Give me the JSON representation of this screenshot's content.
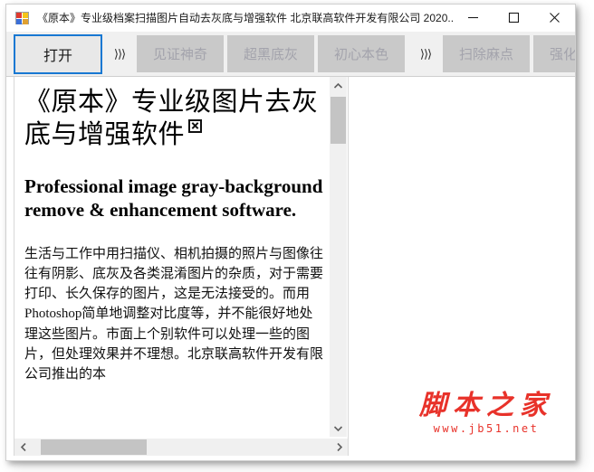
{
  "window": {
    "title": "《原本》专业级档案扫描图片自动去灰底与增强软件 北京联高软件开发有限公司 2020...",
    "icon": "app-grid-icon",
    "controls": {
      "minimize": "minimize-icon",
      "maximize": "maximize-icon",
      "close": "close-icon"
    }
  },
  "toolbar": {
    "open_label": "打开",
    "separator_1": "⟩⟩⟩",
    "separator_2": "⟩⟩⟩",
    "buttons": [
      {
        "label": "见证神奇",
        "enabled": false
      },
      {
        "label": "超黑底灰",
        "enabled": false
      },
      {
        "label": "初心本色",
        "enabled": false
      },
      {
        "label": "扫除麻点",
        "enabled": false
      },
      {
        "label": "强化对比",
        "enabled": false
      }
    ],
    "focus_color": "#1878d2",
    "button_bg": "#c9c9c9",
    "button_disabled_text": "#a3a3ac"
  },
  "document": {
    "heading_cn": "《原本》专业级图片去灰底与增强软件",
    "broken_image_icon": "broken-image-icon",
    "heading_en": "Professional image gray-background remove & enhancement software.",
    "body_part1": "生活与工作中用扫描仪、相机拍摄的照片与图像往往有阴影、底灰及各类混淆图片的杂质，对于需要打印、长久保存的图片，这是无法接受的。而用",
    "body_photoshop": "Photoshop",
    "body_part2": "简单地调整对比度等，并不能很好地处理这些图片。市面上个别软件可以处理一些的图片，但处理效果并不理想。北京联高软件开发有限公司推出的本"
  },
  "scrollbars": {
    "vertical": {
      "up_icon": "chevron-up-icon",
      "down_icon": "chevron-down-icon",
      "thumb": "vertical-scroll-thumb"
    },
    "horizontal": {
      "left_icon": "chevron-left-icon",
      "right_icon": "chevron-right-icon",
      "thumb": "horizontal-scroll-thumb"
    }
  },
  "watermark": {
    "text_cn": "脚本之家",
    "url": "www.jb51.net",
    "color": "#e8322a"
  }
}
